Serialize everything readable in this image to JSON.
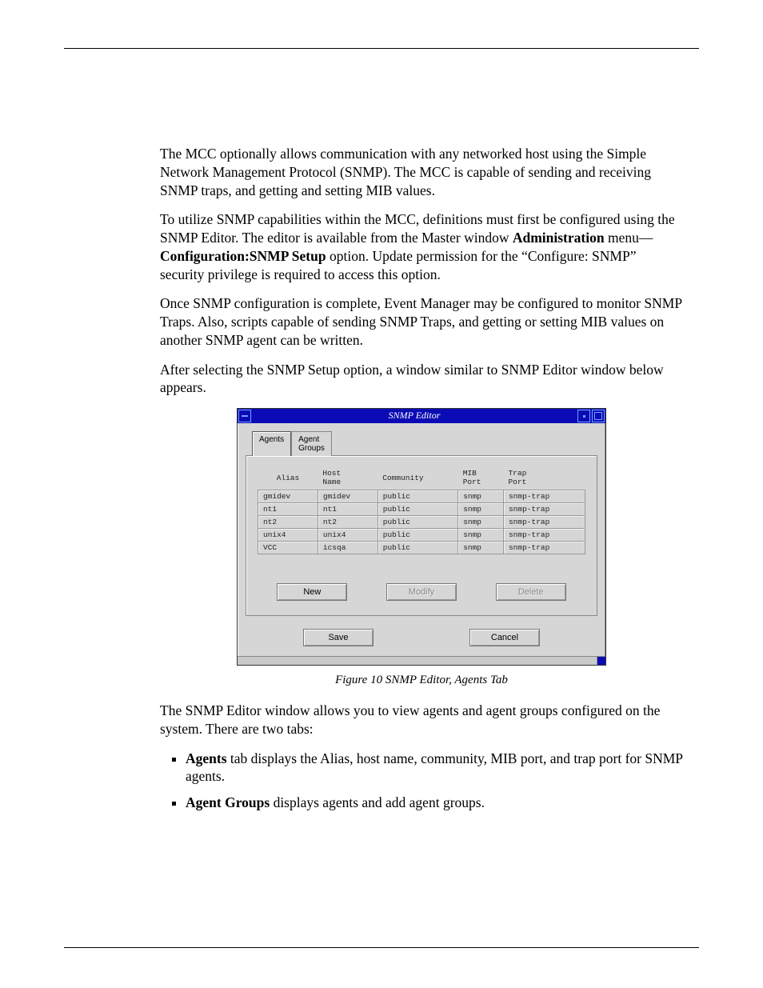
{
  "paragraphs": {
    "p1": "The MCC optionally allows communication with any networked host using the Simple Network Management Protocol (SNMP). The MCC is capable of sending and receiving SNMP traps, and getting and setting MIB values.",
    "p2a": "To utilize SNMP capabilities within the MCC, definitions must first be configured using the SNMP Editor. The editor is available from the Master window ",
    "p2b_bold": "Administration",
    "p2c": " menu—",
    "p2d_bold": "Configuration:SNMP Setup",
    "p2e": " option. Update permission for the “Configure: SNMP” security privilege is required to access this option.",
    "p3": "Once SNMP configuration is complete, Event Manager may be configured to monitor SNMP Traps. Also, scripts capable of sending SNMP Traps, and getting or setting MIB values on another SNMP agent can be written.",
    "p4": "After selecting the SNMP Setup option, a window similar to SNMP Editor window below appears.",
    "p5": "The SNMP Editor window allows you to view agents and agent groups configured on the system. There are two tabs:"
  },
  "figure_caption": "Figure 10 SNMP Editor, Agents Tab",
  "bullets": {
    "b1_bold": "Agents",
    "b1_rest": " tab displays the Alias, host name, community, MIB port, and trap port for SNMP agents.",
    "b2_bold": "Agent Groups",
    "b2_rest": " displays agents and add agent groups."
  },
  "snmp": {
    "title": "SNMP Editor",
    "tabs": {
      "agents": "Agents",
      "groups": "Agent\nGroups"
    },
    "headers": {
      "alias": "Alias",
      "host": "Host\nName",
      "community": "Community",
      "mib": "MIB\nPort",
      "trap": "Trap\nPort"
    },
    "rows": [
      {
        "alias": "gmidev",
        "host": "gmidev",
        "community": "public",
        "mib": "snmp",
        "trap": "snmp-trap"
      },
      {
        "alias": "nt1",
        "host": "nt1",
        "community": "public",
        "mib": "snmp",
        "trap": "snmp-trap"
      },
      {
        "alias": "nt2",
        "host": "nt2",
        "community": "public",
        "mib": "snmp",
        "trap": "snmp-trap"
      },
      {
        "alias": "unix4",
        "host": "unix4",
        "community": "public",
        "mib": "snmp",
        "trap": "snmp-trap"
      },
      {
        "alias": "VCC",
        "host": "icsqa",
        "community": "public",
        "mib": "snmp",
        "trap": "snmp-trap"
      }
    ],
    "buttons": {
      "new": "New",
      "modify": "Modify",
      "delete": "Delete",
      "save": "Save",
      "cancel": "Cancel"
    }
  }
}
